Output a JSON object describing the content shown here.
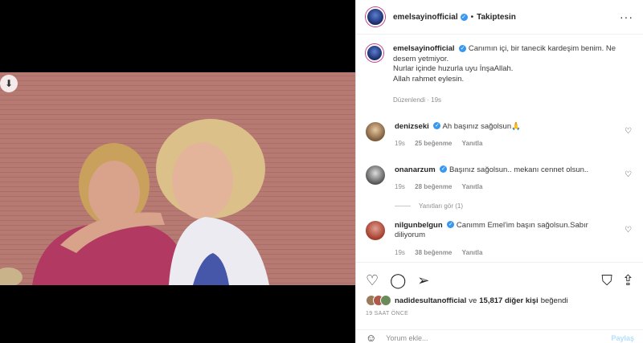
{
  "header": {
    "username": "emelsayinofficial",
    "dot": "•",
    "follow_label": "Takiptesin",
    "more_icon": "more-horizontal-icon"
  },
  "caption": {
    "username": "emelsayinofficial",
    "lines": [
      "Canımın içi, bir tanecik kardeşim benim. Ne desem yetmiyor.",
      "Nurlar içinde huzurla uyu İnşaAllah.",
      "Allah rahmet eylesin."
    ],
    "edited": "Düzenlendi",
    "edited_time": "19s"
  },
  "comments": [
    {
      "username": "denizseki",
      "text": "Ah başınız sağolsun🙏",
      "time": "19s",
      "likes": "25 beğenme",
      "reply": "Yanıtla",
      "avatar_color": "#7a5a3a"
    },
    {
      "username": "onanarzum",
      "text": "Başınız sağolsun.. mekanı cennet olsun..",
      "time": "19s",
      "likes": "28 beğenme",
      "reply": "Yanıtla",
      "avatar_color": "#6f6f6f"
    },
    {
      "username": "nilgunbelgun",
      "text": "Canımm Emel'im başın sağolsun.Sabır diliyorum",
      "time": "19s",
      "likes": "38 beğenme",
      "reply": "Yanıtla",
      "avatar_color": "#a33a2a"
    }
  ],
  "replies_label": "Yanıtları gör (1)",
  "likes": {
    "user": "nadidesultanofficial",
    "and": "ve",
    "count": "15,817 diğer kişi",
    "suffix": "beğendi"
  },
  "post_time": "19 SAAT ÖNCE",
  "comment_input": {
    "placeholder": "Yorum ekle...",
    "post_label": "Paylaş"
  },
  "colors": {
    "verified": "#3897f0",
    "wall": "#b77a73",
    "meta": "#8e8e8e"
  }
}
